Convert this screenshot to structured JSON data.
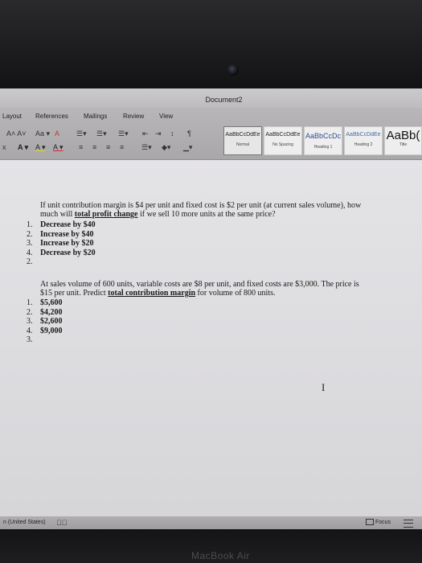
{
  "window": {
    "title": "Document2"
  },
  "ribbon": {
    "tabs": [
      "Layout",
      "References",
      "Mailings",
      "Review",
      "View"
    ],
    "row1": {
      "font_size_buttons": "A˄ A˅",
      "case_button": "Aa ▾",
      "clear_format": "A",
      "pilcrow": "¶"
    },
    "row2": {
      "highlight_button": "A ▾",
      "font_color_button": "A ▾"
    },
    "styles": [
      {
        "sample": "AaBbCcDdEe",
        "name": "Normal"
      },
      {
        "sample": "AaBbCcDdEe",
        "name": "No Spacing"
      },
      {
        "sample": "AaBbCcDc",
        "name": "Heading 1"
      },
      {
        "sample": "AaBbCcDdEe",
        "name": "Heading 2"
      },
      {
        "sample": "AaBb(",
        "name": "Title"
      }
    ]
  },
  "document": {
    "q1": {
      "line1": "If unit contribution margin is $4 per unit and fixed cost is $2 per unit (at current sales volume), how",
      "line2_pre": "much will ",
      "line2_u": "total profit change",
      "line2_post": " if we sell 10 more units at the same price?",
      "options": [
        "Decrease by $40",
        "Increase by $40",
        "Increase by $20",
        "Decrease by $20"
      ],
      "trailing_number": "2."
    },
    "q2": {
      "line1": "At sales volume of 600 units, variable costs are $8 per unit, and fixed costs are $3,000. The price is",
      "line2_pre": "$15 per unit. Predict ",
      "line2_u": "total contribution margin",
      "line2_post": " for volume of 800 units.",
      "options": [
        "$5,600",
        "$4,200",
        "$2,600",
        "$9,000"
      ],
      "trailing_number": "3."
    },
    "cursor": "I"
  },
  "statusbar": {
    "language": "n (United States)",
    "focus_label": "Focus"
  },
  "bezel": {
    "label": "MacBook Air"
  }
}
